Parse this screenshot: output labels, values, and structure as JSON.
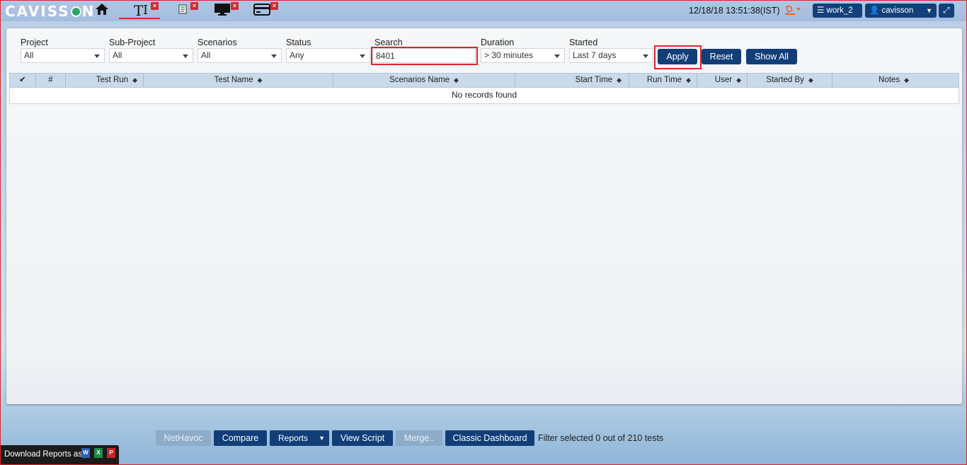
{
  "topbar": {
    "logo": "CAVISS",
    "logo_tail": "N",
    "datetime": "12/18/18 13:51:38(IST)",
    "workspace_label": "work_2",
    "user_label": "cavisson"
  },
  "filters": {
    "project": {
      "label": "Project",
      "value": "All"
    },
    "sub_project": {
      "label": "Sub-Project",
      "value": "All"
    },
    "scenarios": {
      "label": "Scenarios",
      "value": "All"
    },
    "status": {
      "label": "Status",
      "value": "Any"
    },
    "search": {
      "label": "Search",
      "value": "8401"
    },
    "duration": {
      "label": "Duration",
      "value": "> 30 minutes"
    },
    "started": {
      "label": "Started",
      "value": "Last 7 days"
    }
  },
  "actions": {
    "apply": "Apply",
    "reset": "Reset",
    "show_all": "Show All"
  },
  "table": {
    "columns": [
      "#",
      "Test Run",
      "Test Name",
      "Scenarios Name",
      "Start Time",
      "Run Time",
      "User",
      "Started By",
      "Notes"
    ],
    "empty_message": "No records found"
  },
  "bottom": {
    "nethavoc": "NetHavoc",
    "compare": "Compare",
    "reports": "Reports",
    "view_script": "View Script",
    "merge": "Merge..",
    "classic_dashboard": "Classic Dashboard",
    "filter_info": "Filter selected 0 out of 210 tests",
    "download_label": "Download Reports as:"
  },
  "colors": {
    "accent": "#123e78",
    "highlight": "#d9262c",
    "header_bg": "#c9daea"
  }
}
